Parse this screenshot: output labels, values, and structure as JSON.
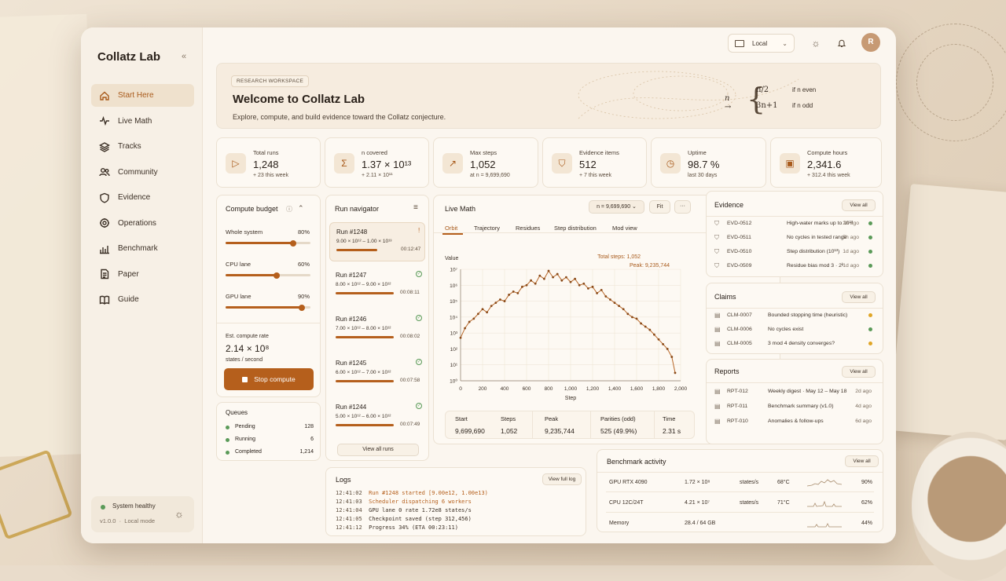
{
  "app": {
    "title": "Collatz Lab",
    "collapse_icon": "«"
  },
  "nav": [
    {
      "label": "Start Here",
      "icon": "home-icon",
      "active": true
    },
    {
      "label": "Live Math",
      "icon": "pulse-icon"
    },
    {
      "label": "Tracks",
      "icon": "layers-icon"
    },
    {
      "label": "Community",
      "icon": "users-icon"
    },
    {
      "label": "Evidence",
      "icon": "shield-icon"
    },
    {
      "label": "Operations",
      "icon": "gear-icon"
    },
    {
      "label": "Benchmark",
      "icon": "bar-chart-icon"
    },
    {
      "label": "Paper",
      "icon": "document-icon"
    },
    {
      "label": "Guide",
      "icon": "book-icon"
    }
  ],
  "system": {
    "status": "System healthy",
    "version": "v1.0.0",
    "mode": "Local mode"
  },
  "topbar": {
    "env": "Local",
    "avatar": "R"
  },
  "hero": {
    "tag": "RESEARCH WORKSPACE",
    "title": "Welcome to Collatz Lab",
    "subtitle": "Explore, compute, and build evidence toward the Collatz conjecture.",
    "formula_n": "n →",
    "case1": "n/2",
    "case1_cond": "if n even",
    "case2": "3n+1",
    "case2_cond": "if n odd"
  },
  "stats": [
    {
      "label": "Total runs",
      "value": "1,248",
      "delta": "+ 23 this week",
      "icon": "play-icon"
    },
    {
      "label": "n covered",
      "value": "1.37 × 10¹³",
      "delta": "+ 2.11 × 10¹¹",
      "icon": "sigma-icon"
    },
    {
      "label": "Max steps",
      "value": "1,052",
      "delta": "at n = 9,699,690",
      "icon": "trend-icon"
    },
    {
      "label": "Evidence items",
      "value": "512",
      "delta": "+ 7 this week",
      "icon": "shield-icon"
    },
    {
      "label": "Uptime",
      "value": "98.7 %",
      "delta": "last 30 days",
      "icon": "clock-icon"
    },
    {
      "label": "Compute hours",
      "value": "2,341.6",
      "delta": "+ 312.4 this week",
      "icon": "chip-icon"
    }
  ],
  "budget": {
    "title": "Compute budget",
    "sliders": [
      {
        "label": "Whole system",
        "value_text": "80%",
        "value": 0.8
      },
      {
        "label": "CPU lane",
        "value_text": "60%",
        "value": 0.6
      },
      {
        "label": "GPU lane",
        "value_text": "90%",
        "value": 0.9
      }
    ],
    "rate_label": "Est. compute rate",
    "rate_value": "2.14 × 10⁸",
    "rate_unit": "states / second",
    "stop_label": "Stop compute"
  },
  "queues": {
    "title": "Queues",
    "items": [
      {
        "label": "Pending",
        "count": "128"
      },
      {
        "label": "Running",
        "count": "6"
      },
      {
        "label": "Completed",
        "count": "1,214"
      }
    ]
  },
  "runs": {
    "title": "Run navigator",
    "items": [
      {
        "name": "Run #1248",
        "range": "9.00 × 10¹² – 1.00 × 10¹³",
        "time": "00:12:47",
        "status": "running",
        "progress": 0.7
      },
      {
        "name": "Run #1247",
        "range": "8.00 × 10¹² – 9.00 × 10¹²",
        "time": "00:08:11",
        "status": "done",
        "progress": 1
      },
      {
        "name": "Run #1246",
        "range": "7.00 × 10¹² – 8.00 × 10¹²",
        "time": "00:08:02",
        "status": "done",
        "progress": 1
      },
      {
        "name": "Run #1245",
        "range": "6.00 × 10¹² – 7.00 × 10¹²",
        "time": "00:07:58",
        "status": "done",
        "progress": 1
      },
      {
        "name": "Run #1244",
        "range": "5.00 × 10¹² – 6.00 × 10¹²",
        "time": "00:07:49",
        "status": "done",
        "progress": 1
      }
    ],
    "view_all": "View all runs"
  },
  "live": {
    "title": "Live Math",
    "n_select": "n = 9,699,690",
    "fit": "Fit",
    "tabs": [
      "Orbit",
      "Trajectory",
      "Residues",
      "Step distribution",
      "Mod view"
    ],
    "y_label": "Value",
    "x_label": "Step",
    "total_steps": "Total steps: 1,052",
    "peak": "Peak: 9,235,744",
    "y_ticks": [
      "10⁷",
      "10⁶",
      "10⁵",
      "10⁴",
      "10³",
      "10²",
      "10¹",
      "10⁰"
    ],
    "x_ticks": [
      "0",
      "200",
      "400",
      "600",
      "800",
      "1,000",
      "1,200",
      "1,400",
      "1,600",
      "1,800",
      "2,000"
    ],
    "summary": [
      {
        "label": "Start",
        "value": "9,699,690"
      },
      {
        "label": "Steps",
        "value": "1,052"
      },
      {
        "label": "Peak",
        "value": "9,235,744"
      },
      {
        "label": "Parities (odd)",
        "value": "525 (49.9%)"
      },
      {
        "label": "Time",
        "value": "2.31 s"
      }
    ]
  },
  "chart_data": {
    "type": "line",
    "ylabel": "Value",
    "xlabel": "Step",
    "xlim": [
      0,
      2000
    ],
    "ylim_log10": [
      0,
      7
    ],
    "x": [
      0,
      40,
      80,
      120,
      160,
      200,
      240,
      280,
      320,
      360,
      400,
      440,
      480,
      520,
      560,
      600,
      640,
      680,
      720,
      760,
      800,
      840,
      880,
      920,
      960,
      1000,
      1040,
      1080,
      1120,
      1160,
      1200,
      1240,
      1280,
      1320,
      1360,
      1400,
      1440,
      1480,
      1520,
      1560,
      1600,
      1640,
      1680,
      1720,
      1760,
      1800,
      1840,
      1880,
      1920,
      1950
    ],
    "log10_y": [
      2.7,
      3.3,
      3.7,
      3.9,
      4.2,
      4.5,
      4.3,
      4.7,
      4.9,
      5.1,
      5.0,
      5.4,
      5.6,
      5.5,
      5.9,
      6.0,
      6.3,
      6.1,
      6.6,
      6.4,
      6.9,
      6.5,
      6.7,
      6.3,
      6.5,
      6.2,
      6.4,
      6.0,
      6.1,
      5.8,
      5.9,
      5.5,
      5.7,
      5.3,
      5.1,
      4.9,
      4.7,
      4.5,
      4.2,
      4.0,
      3.9,
      3.6,
      3.4,
      3.2,
      2.9,
      2.6,
      2.3,
      2.0,
      1.5,
      0.5
    ]
  },
  "evidence": {
    "title": "Evidence",
    "view_all": "View all",
    "items": [
      {
        "id": "EVD-0512",
        "text": "High-water marks up to 10¹³",
        "time": "2h ago",
        "color": "#5a9a58"
      },
      {
        "id": "EVD-0511",
        "text": "No cycles in tested range",
        "time": "5h ago",
        "color": "#5a9a58"
      },
      {
        "id": "EVD-0510",
        "text": "Step distribution (10¹³)",
        "time": "1d ago",
        "color": "#5a9a58"
      },
      {
        "id": "EVD-0509",
        "text": "Residue bias mod 3 · 2ᵏ",
        "time": "1d ago",
        "color": "#5a9a58"
      }
    ]
  },
  "claims": {
    "title": "Claims",
    "view_all": "View all",
    "items": [
      {
        "id": "CLM-0007",
        "text": "Bounded stopping time (heuristic)",
        "color": "#e0a526"
      },
      {
        "id": "CLM-0006",
        "text": "No cycles exist",
        "color": "#5a9a58"
      },
      {
        "id": "CLM-0005",
        "text": "3 mod 4 density converges?",
        "color": "#e0a526"
      }
    ]
  },
  "reports": {
    "title": "Reports",
    "view_all": "View all",
    "items": [
      {
        "id": "RPT-012",
        "text": "Weekly digest · May 12 – May 18",
        "time": "2d ago"
      },
      {
        "id": "RPT-011",
        "text": "Benchmark summary (v1.0)",
        "time": "4d ago"
      },
      {
        "id": "RPT-010",
        "text": "Anomalies & follow-ups",
        "time": "6d ago"
      }
    ]
  },
  "logs": {
    "title": "Logs",
    "view_full": "View full log",
    "lines": [
      {
        "ts": "12:41:02",
        "msg": "Run #1248 started [9.00e12, 1.00e13)",
        "hl": true
      },
      {
        "ts": "12:41:03",
        "msg": "Scheduler dispatching 6 workers",
        "hl": true
      },
      {
        "ts": "12:41:04",
        "msg": "GPU lane 0 rate 1.72e8 states/s",
        "hl": false
      },
      {
        "ts": "12:41:05",
        "msg": "Checkpoint saved (step 312,456)",
        "hl": false
      },
      {
        "ts": "12:41:12",
        "msg": "Progress 34% (ETA 00:23:11)",
        "hl": false
      }
    ]
  },
  "bench": {
    "title": "Benchmark activity",
    "view_all": "View all",
    "rows": [
      {
        "name": "GPU RTX 4090",
        "rate": "1.72 × 10⁸",
        "unit": "states/s",
        "temp": "68°C",
        "util": "90%"
      },
      {
        "name": "CPU 12C/24T",
        "rate": "4.21 × 10⁷",
        "unit": "states/s",
        "temp": "71°C",
        "util": "62%"
      },
      {
        "name": "Memory",
        "rate": "28.4 / 64 GB",
        "unit": "",
        "temp": "",
        "util": "44%"
      }
    ]
  }
}
